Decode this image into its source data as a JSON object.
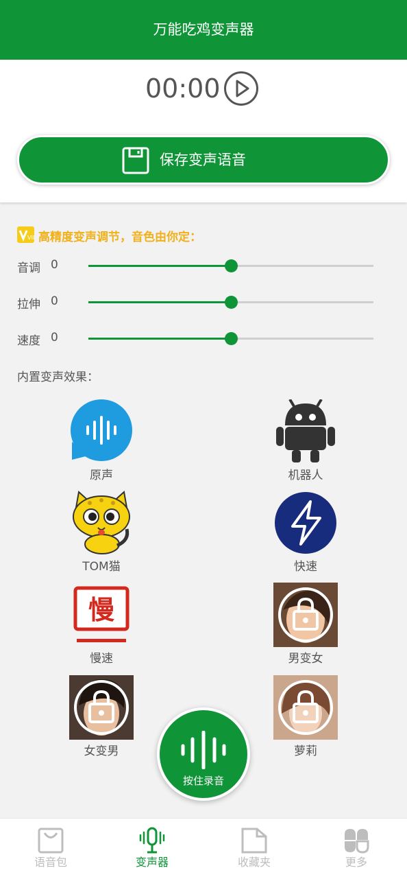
{
  "header": {
    "title": "万能吃鸡变声器"
  },
  "player": {
    "time": "00:00"
  },
  "save_button": {
    "label": "保存变声语音"
  },
  "tuning": {
    "vip_badge": "VIP",
    "hint": "高精度变声调节，音色由你定：",
    "sliders": [
      {
        "label": "音调",
        "value": "0",
        "level": 0.5
      },
      {
        "label": "拉伸",
        "value": "0",
        "level": 0.5
      },
      {
        "label": "速度",
        "value": "0",
        "level": 0.5
      }
    ]
  },
  "effects": {
    "title": "内置变声效果：",
    "items": [
      {
        "label": "原声",
        "icon": "voice-bubble-icon",
        "locked": false
      },
      {
        "label": "机器人",
        "icon": "robot-icon",
        "locked": false
      },
      {
        "label": "TOM猫",
        "icon": "tom-cat-icon",
        "locked": false
      },
      {
        "label": "快速",
        "icon": "lightning-icon",
        "locked": false
      },
      {
        "label": "慢速",
        "icon": "slow-icon",
        "locked": false
      },
      {
        "label": "男变女",
        "icon": "lock-icon",
        "locked": true
      },
      {
        "label": "女变男",
        "icon": "lock-icon",
        "locked": true
      },
      {
        "label": "萝莉",
        "icon": "lock-icon",
        "locked": true
      }
    ]
  },
  "record_button": {
    "label": "按住录音"
  },
  "tabs": [
    {
      "label": "语音包",
      "icon": "bag-icon",
      "active": false
    },
    {
      "label": "变声器",
      "icon": "microphone-icon",
      "active": true
    },
    {
      "label": "收藏夹",
      "icon": "folder-icon",
      "active": false
    },
    {
      "label": "更多",
      "icon": "clover-icon",
      "active": false
    }
  ],
  "colors": {
    "brand": "#0f9538",
    "vip": "#f0b11a",
    "muted": "#555555",
    "tab_inactive": "#bdbdbd"
  }
}
